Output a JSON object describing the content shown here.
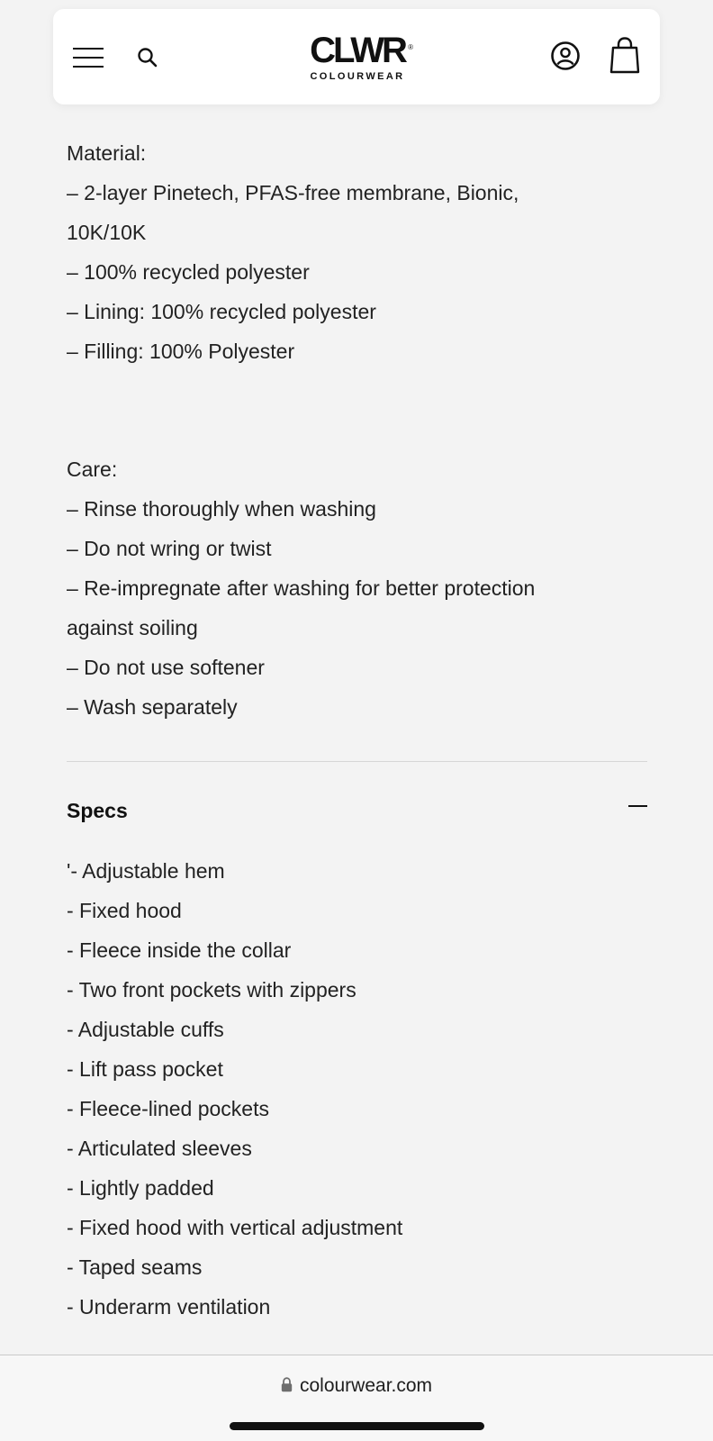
{
  "header": {
    "logo_mark": "CLWR",
    "logo_registered": "®",
    "logo_sub": "COLOURWEAR",
    "icons": [
      "menu-icon",
      "search-icon",
      "account-icon",
      "cart-icon"
    ]
  },
  "material": {
    "lines": [
      "Material:",
      "– 2-layer Pinetech, PFAS-free membrane, Bionic,",
      "10K/10K",
      "– 100% recycled polyester",
      "– Lining: 100% recycled polyester",
      "– Filling: 100% Polyester"
    ]
  },
  "care": {
    "lines": [
      "Care:",
      "– Rinse thoroughly when washing",
      "– Do not wring or twist",
      "– Re-impregnate after washing for better protection",
      "against soiling",
      "– Do not use softener",
      "– Wash separately"
    ]
  },
  "specs": {
    "title": "Specs",
    "expanded": true,
    "items": [
      "'- Adjustable hem",
      "- Fixed hood",
      "- Fleece inside the collar",
      "- Two front pockets with zippers",
      "- Adjustable cuffs",
      "- Lift pass pocket",
      "- Fleece-lined pockets",
      "- Articulated sleeves",
      "- Lightly padded",
      "- Fixed hood with vertical adjustment",
      "- Taped seams",
      "- Underarm ventilation"
    ]
  },
  "browser": {
    "url": "colourwear.com"
  }
}
